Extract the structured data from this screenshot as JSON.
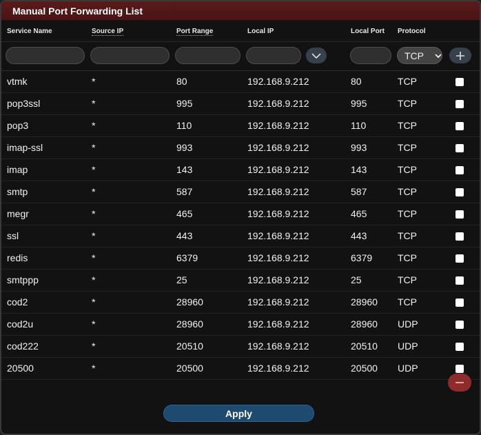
{
  "title": "Manual Port Forwarding List",
  "columns": {
    "service_name": "Service Name",
    "source_ip": "Source IP",
    "port_range": "Port Range",
    "local_ip": "Local IP",
    "local_port": "Local Port",
    "protocol": "Protocol"
  },
  "new_entry": {
    "service_name": "",
    "source_ip": "",
    "port_range": "",
    "local_ip": "",
    "local_port": "",
    "protocol": "TCP"
  },
  "rules": [
    {
      "service": "vtmk",
      "source": "*",
      "port_range": "80",
      "local_ip": "192.168.9.212",
      "local_port": "80",
      "protocol": "TCP"
    },
    {
      "service": "pop3ssl",
      "source": "*",
      "port_range": "995",
      "local_ip": "192.168.9.212",
      "local_port": "995",
      "protocol": "TCP"
    },
    {
      "service": "pop3",
      "source": "*",
      "port_range": "110",
      "local_ip": "192.168.9.212",
      "local_port": "110",
      "protocol": "TCP"
    },
    {
      "service": "imap-ssl",
      "source": "*",
      "port_range": "993",
      "local_ip": "192.168.9.212",
      "local_port": "993",
      "protocol": "TCP"
    },
    {
      "service": "imap",
      "source": "*",
      "port_range": "143",
      "local_ip": "192.168.9.212",
      "local_port": "143",
      "protocol": "TCP"
    },
    {
      "service": "smtp",
      "source": "*",
      "port_range": "587",
      "local_ip": "192.168.9.212",
      "local_port": "587",
      "protocol": "TCP"
    },
    {
      "service": "megr",
      "source": "*",
      "port_range": "465",
      "local_ip": "192.168.9.212",
      "local_port": "465",
      "protocol": "TCP"
    },
    {
      "service": "ssl",
      "source": "*",
      "port_range": "443",
      "local_ip": "192.168.9.212",
      "local_port": "443",
      "protocol": "TCP"
    },
    {
      "service": "redis",
      "source": "*",
      "port_range": "6379",
      "local_ip": "192.168.9.212",
      "local_port": "6379",
      "protocol": "TCP"
    },
    {
      "service": "smtppp",
      "source": "*",
      "port_range": "25",
      "local_ip": "192.168.9.212",
      "local_port": "25",
      "protocol": "TCP"
    },
    {
      "service": "cod2",
      "source": "*",
      "port_range": "28960",
      "local_ip": "192.168.9.212",
      "local_port": "28960",
      "protocol": "TCP"
    },
    {
      "service": "cod2u",
      "source": "*",
      "port_range": "28960",
      "local_ip": "192.168.9.212",
      "local_port": "28960",
      "protocol": "UDP"
    },
    {
      "service": "cod222",
      "source": "*",
      "port_range": "20510",
      "local_ip": "192.168.9.212",
      "local_port": "20510",
      "protocol": "UDP"
    },
    {
      "service": "20500",
      "source": "*",
      "port_range": "20500",
      "local_ip": "192.168.9.212",
      "local_port": "20500",
      "protocol": "UDP"
    }
  ],
  "buttons": {
    "apply": "Apply",
    "add_icon": "plus-icon",
    "delete_icon": "minus-icon",
    "device_list_icon": "chevron-down-icon"
  },
  "colors": {
    "titlebar": "#5a1a1a",
    "apply_button": "#1d4a6e",
    "delete_button": "#8e2b2b",
    "background": "#121212"
  }
}
